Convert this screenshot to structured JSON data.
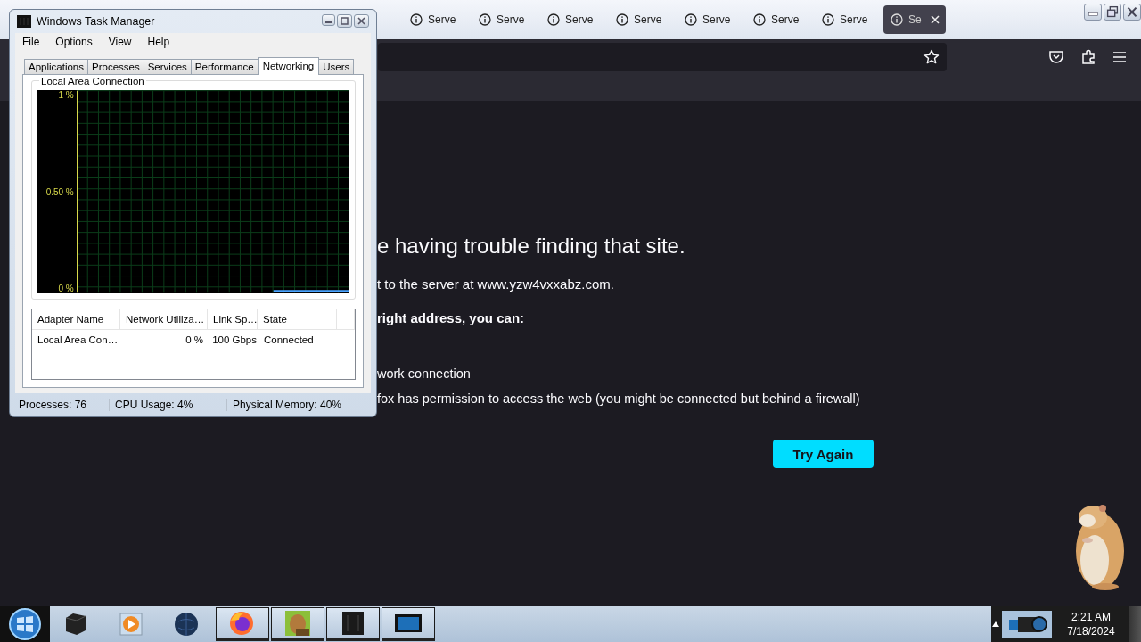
{
  "browser": {
    "tabs": [
      {
        "label": "Serve",
        "selected": false
      },
      {
        "label": "Serve",
        "selected": false
      },
      {
        "label": "Serve",
        "selected": false
      },
      {
        "label": "Serve",
        "selected": false
      },
      {
        "label": "Serve",
        "selected": false
      },
      {
        "label": "Serve",
        "selected": false
      },
      {
        "label": "Serve",
        "selected": false
      },
      {
        "label": "Se",
        "selected": true
      }
    ],
    "error": {
      "heading": "e having trouble finding that site.",
      "message": "t to the server at www.yzw4vxxabz.com.",
      "advice": "right address, you can:",
      "tips": [
        "work connection",
        "fox has permission to access the web (you might be connected but behind a firewall)"
      ],
      "button": "Try Again"
    }
  },
  "task_manager": {
    "title": "Windows Task Manager",
    "menu": [
      "File",
      "Options",
      "View",
      "Help"
    ],
    "tabs": [
      {
        "label": "Applications",
        "selected": false
      },
      {
        "label": "Processes",
        "selected": false
      },
      {
        "label": "Services",
        "selected": false
      },
      {
        "label": "Performance",
        "selected": false
      },
      {
        "label": "Networking",
        "selected": true
      },
      {
        "label": "Users",
        "selected": false
      }
    ],
    "graph": {
      "title": "Local Area Connection",
      "scale_labels": [
        "1 %",
        "0.50 %",
        "0 %"
      ]
    },
    "adapters": {
      "columns": [
        "Adapter Name",
        "Network Utiliza…",
        "Link Sp…",
        "State"
      ],
      "rows": [
        [
          "Local Area Con…",
          "0 %",
          "100 Gbps",
          "Connected"
        ]
      ]
    },
    "status_bar": [
      "Processes: 76",
      "CPU Usage: 4%",
      "Physical Memory: 40%"
    ]
  },
  "taskbar": {
    "apps": [
      {
        "kind": "cube",
        "running": false
      },
      {
        "kind": "player",
        "running": false
      },
      {
        "kind": "globe",
        "running": false
      },
      {
        "kind": "firefox",
        "running": true
      },
      {
        "kind": "pet",
        "running": true
      },
      {
        "kind": "dark",
        "running": true
      },
      {
        "kind": "screen",
        "running": true
      }
    ],
    "clock": {
      "time": "2:21 AM",
      "date": "7/18/2024"
    }
  }
}
